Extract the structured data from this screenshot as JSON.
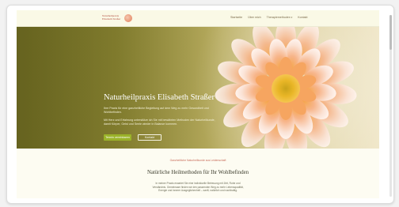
{
  "header": {
    "logo_text": "Naturheilpraxis Elisabeth Straßer",
    "logo_icon": "flower-logo-icon",
    "nav": [
      {
        "label": "Startseite"
      },
      {
        "label": "Über mich"
      },
      {
        "label": "Therapiemethoden",
        "icon": "chevron-down-icon"
      },
      {
        "label": "Kontakt"
      }
    ]
  },
  "hero": {
    "title": "Naturheilpraxis Elisabeth Straßer",
    "text_1": "Ihre Praxis für eine ganzheitliche Begleitung auf dem Weg zu mehr Gesundheit und Wohlbefinden.",
    "text_2": "Mit Herz und Erfahrung unterstütze ich Sie mit bewährten Methoden der Naturheilkunde, damit Körper, Geist und Seele wieder in Balance kommen.",
    "primary_button": "Termin vereinbaren",
    "secondary_button": "Kontakt"
  },
  "intro": {
    "eyebrow": "Ganzheitliche Naturheilkunde aus Leidenschaft",
    "title": "Natürliche Heilmethoden für Ihr Wohlbefinden",
    "text": "In meiner Praxis erwartet Sie eine individuelle Betreuung mit Zeit, Ruhe und Verständnis. Gemeinsam finden wir den passenden Weg zu mehr Lebensqualität, Energie und innerer Ausgeglichenheit – sanft, natürlich und nachhaltig."
  },
  "colors": {
    "accent": "#9bb32a",
    "brand": "#b04a3c",
    "background": "#fdfcf2"
  }
}
